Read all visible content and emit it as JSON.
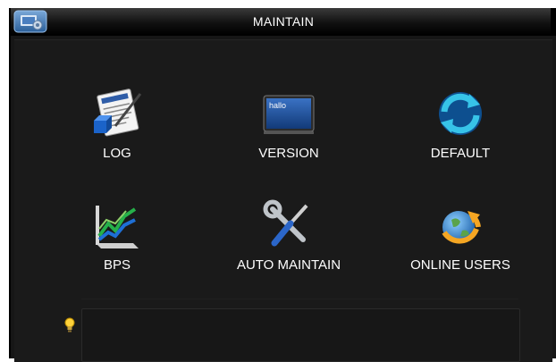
{
  "window": {
    "title": "MAINTAIN"
  },
  "tiles": [
    {
      "label": "LOG",
      "icon": "log-icon"
    },
    {
      "label": "VERSION",
      "icon": "version-icon",
      "screen_text": "hallo"
    },
    {
      "label": "DEFAULT",
      "icon": "refresh-icon"
    },
    {
      "label": "BPS",
      "icon": "bps-chart-icon"
    },
    {
      "label": "AUTO MAINTAIN",
      "icon": "wrench-screwdriver-icon"
    },
    {
      "label": "ONLINE USERS",
      "icon": "globe-user-icon"
    }
  ],
  "tip": {
    "icon": "lightbulb-icon",
    "text": ""
  },
  "colors": {
    "window_bg": "#161616",
    "titlebar": "#111111",
    "text": "#ffffff",
    "accent_blue": "#1e90ff",
    "accent_orange": "#f5a623"
  }
}
